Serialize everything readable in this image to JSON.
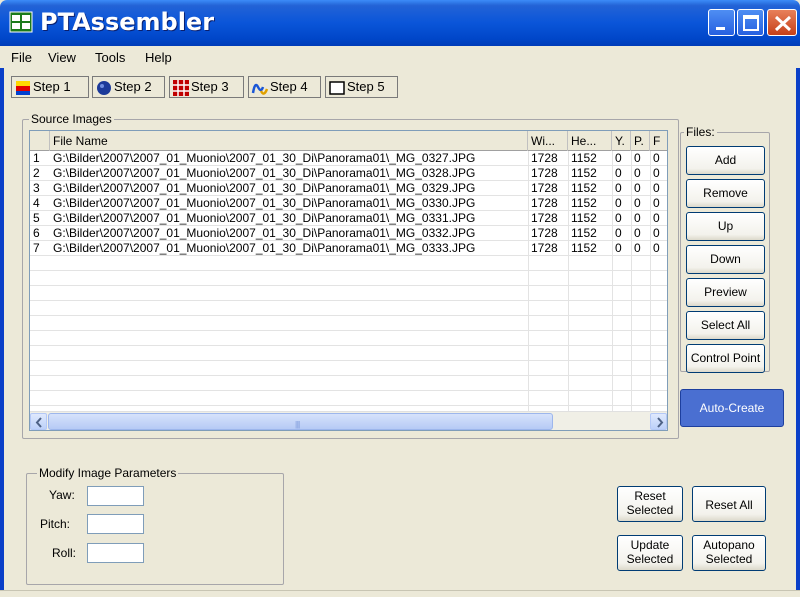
{
  "window": {
    "title": "PTAssembler"
  },
  "menu": [
    "File",
    "View",
    "Tools",
    "Help"
  ],
  "steps": [
    "Step 1",
    "Step 2",
    "Step 3",
    "Step 4",
    "Step 5"
  ],
  "source_images": {
    "group_label": "Source Images",
    "columns": [
      "File Name",
      "Wi...",
      "He...",
      "Y.",
      "P.",
      "F"
    ],
    "rows": [
      {
        "n": "1",
        "file": "G:\\Bilder\\2007\\2007_01_Muonio\\2007_01_30_Di\\Panorama01\\_MG_0327.JPG",
        "w": "1728",
        "h": "1152",
        "y": "0",
        "p": "0",
        "f": "0"
      },
      {
        "n": "2",
        "file": "G:\\Bilder\\2007\\2007_01_Muonio\\2007_01_30_Di\\Panorama01\\_MG_0328.JPG",
        "w": "1728",
        "h": "1152",
        "y": "0",
        "p": "0",
        "f": "0"
      },
      {
        "n": "3",
        "file": "G:\\Bilder\\2007\\2007_01_Muonio\\2007_01_30_Di\\Panorama01\\_MG_0329.JPG",
        "w": "1728",
        "h": "1152",
        "y": "0",
        "p": "0",
        "f": "0"
      },
      {
        "n": "4",
        "file": "G:\\Bilder\\2007\\2007_01_Muonio\\2007_01_30_Di\\Panorama01\\_MG_0330.JPG",
        "w": "1728",
        "h": "1152",
        "y": "0",
        "p": "0",
        "f": "0"
      },
      {
        "n": "5",
        "file": "G:\\Bilder\\2007\\2007_01_Muonio\\2007_01_30_Di\\Panorama01\\_MG_0331.JPG",
        "w": "1728",
        "h": "1152",
        "y": "0",
        "p": "0",
        "f": "0"
      },
      {
        "n": "6",
        "file": "G:\\Bilder\\2007\\2007_01_Muonio\\2007_01_30_Di\\Panorama01\\_MG_0332.JPG",
        "w": "1728",
        "h": "1152",
        "y": "0",
        "p": "0",
        "f": "0"
      },
      {
        "n": "7",
        "file": "G:\\Bilder\\2007\\2007_01_Muonio\\2007_01_30_Di\\Panorama01\\_MG_0333.JPG",
        "w": "1728",
        "h": "1152",
        "y": "0",
        "p": "0",
        "f": "0"
      }
    ]
  },
  "files_panel": {
    "label": "Files:",
    "buttons": [
      "Add",
      "Remove",
      "Up",
      "Down",
      "Preview",
      "Select All",
      "Control Point"
    ],
    "auto_create": "Auto-Create"
  },
  "modify": {
    "group_label": "Modify Image Parameters",
    "yaw_label": "Yaw:",
    "pitch_label": "Pitch:",
    "roll_label": "Roll:",
    "yaw_value": "",
    "pitch_value": "",
    "roll_value": "",
    "reset_selected": [
      "Reset",
      "Selected"
    ],
    "reset_all": "Reset All",
    "update_selected": [
      "Update",
      "Selected"
    ],
    "autopano_selected": [
      "Autopano",
      "Selected"
    ]
  },
  "colors": {
    "title_bar": "#0a55d9",
    "auto_create_bg": "#4a6fd1",
    "face": "#ece9d8"
  }
}
